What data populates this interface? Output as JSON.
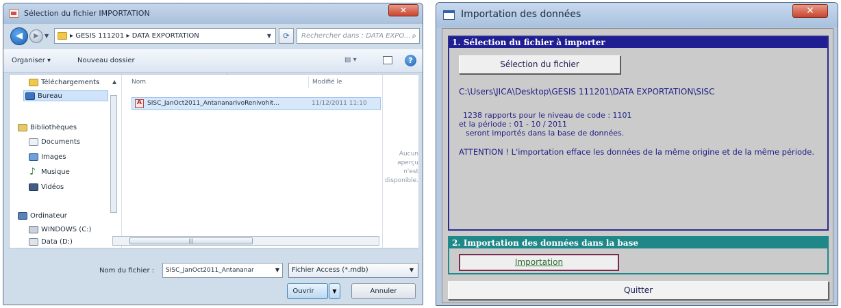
{
  "file_dialog": {
    "title": "Sélection du fichier IMPORTATION",
    "close_label": "✕",
    "address": {
      "crumb1": "GESIS 111201",
      "crumb2": "DATA EXPORTATION",
      "separator": "▸"
    },
    "search_placeholder": "Rechercher dans : DATA EXPO...",
    "toolbar": {
      "organize": "Organiser ▾",
      "new_folder": "Nouveau dossier"
    },
    "nav": {
      "downloads": "Téléchargements",
      "desktop": "Bureau",
      "libraries": "Bibliothèques",
      "documents": "Documents",
      "images": "Images",
      "music": "Musique",
      "videos": "Vidéos",
      "computer": "Ordinateur",
      "drive_c": "WINDOWS (C:)",
      "drive_d": "Data (D:)"
    },
    "columns": {
      "name": "Nom",
      "modified": "Modifié le"
    },
    "files": [
      {
        "name": "SISC_JanOct2011_AntananarivoRenivohit...",
        "modified": "11/12/2011 11:10"
      }
    ],
    "preview_text": "Aucun aperçu n'est disponible.",
    "filename_label": "Nom du fichier :",
    "filename_value": "SISC_JanOct2011_Antananar",
    "filetype_value": "Fichier Access (*.mdb)",
    "open_button": "Ouvrir",
    "cancel_button": "Annuler"
  },
  "import_window": {
    "title": "Importation des données",
    "close_label": "✕",
    "section1": {
      "heading": "1. Sélection du fichier à importer",
      "select_button": "Sélection du fichier",
      "path": "C:\\Users\\JICA\\Desktop\\GESIS 111201\\DATA EXPORTATION\\SISC",
      "line1": "1238  rapports pour le niveau de code : 1101",
      "line2": "et la période : 01 - 10 / 2011",
      "line3": "seront importés dans la base de données.",
      "warning": "ATTENTION ! L'importation efface les données de la même origine et de la même période."
    },
    "section2": {
      "heading": "2. Importation des données dans la base",
      "import_button": "Importation"
    },
    "quit_button": "Quitter"
  }
}
